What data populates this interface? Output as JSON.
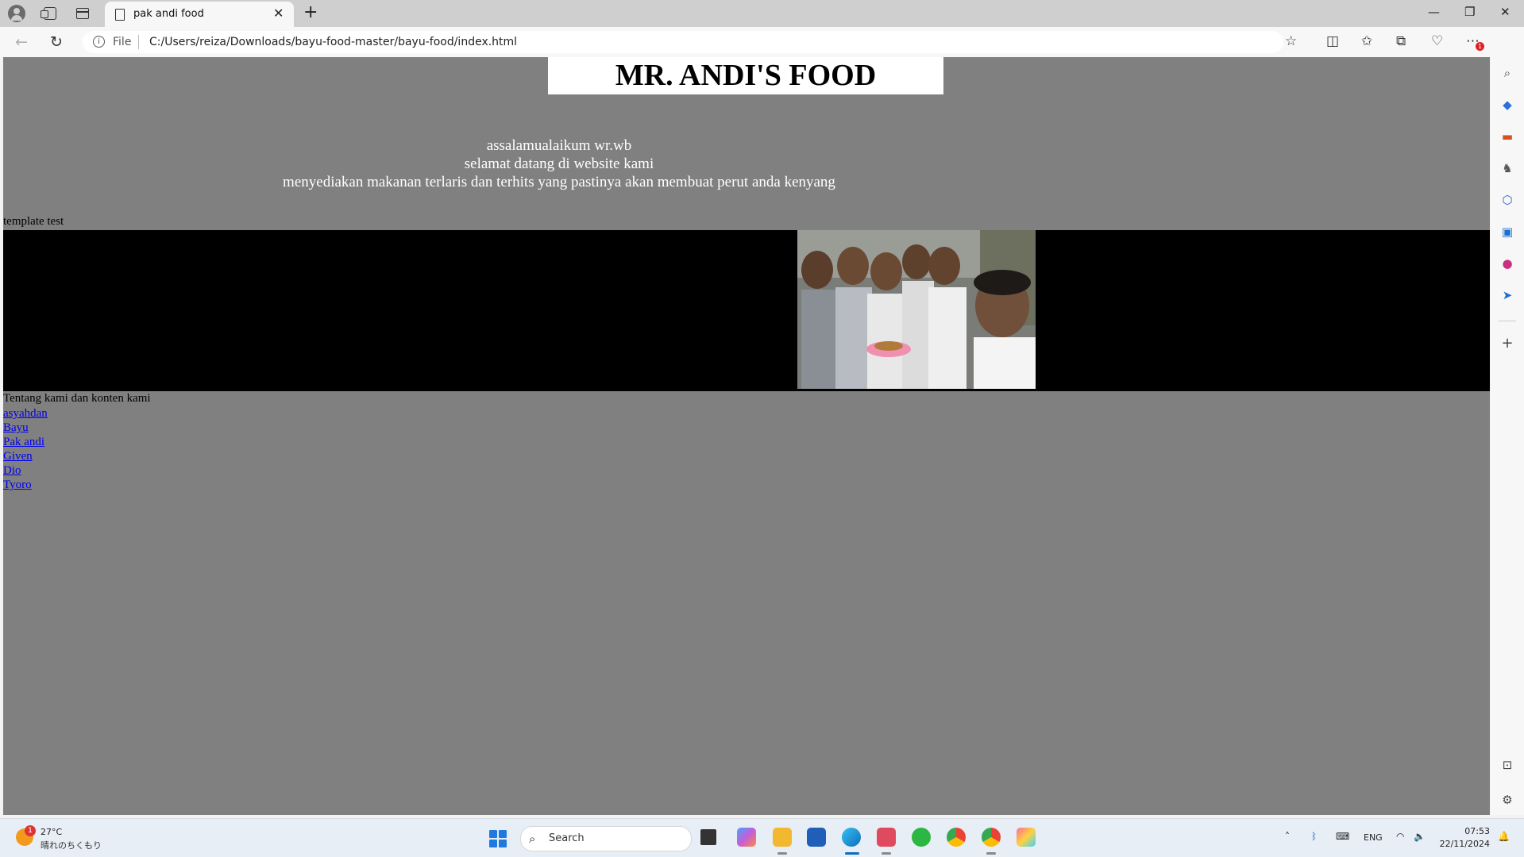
{
  "browser": {
    "tab_title": "pak andi food",
    "url_scheme_label": "File",
    "url": "C:/Users/reiza/Downloads/bayu-food-master/bayu-food/index.html",
    "extensions_badge": "1"
  },
  "page": {
    "header_title": "MR. ANDI'S FOOD",
    "welcome_lines": [
      "assalamualaikum wr.wb",
      "selamat datang di website kami",
      "menyediakan makanan terlaris dan terhits yang pastinya akan membuat perut anda kenyang"
    ],
    "template_label": "template test",
    "about_label": "Tentang kami dan konten kami",
    "links": [
      "asyahdan",
      "Bayu",
      "Pak andi",
      "Given",
      "Dio",
      "Tyoro"
    ]
  },
  "taskbar": {
    "weather_badge": "1",
    "temperature": "27°C",
    "weather_desc": "晴れのちくもり",
    "search_placeholder": "Search",
    "language": "ENG",
    "time": "07:53",
    "date": "22/11/2024"
  },
  "colors": {
    "page_background": "#808080",
    "banner_background": "#000000",
    "link": "#0000ee",
    "header_box": "#ffffff"
  }
}
